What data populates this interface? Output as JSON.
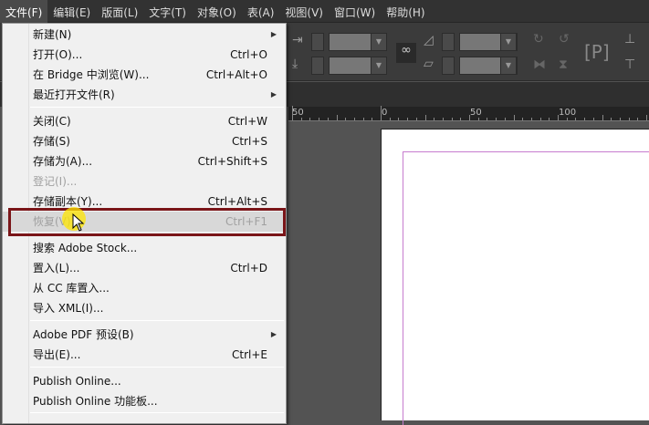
{
  "menubar": [
    "文件(F)",
    "编辑(E)",
    "版面(L)",
    "文字(T)",
    "对象(O)",
    "表(A)",
    "视图(V)",
    "窗口(W)",
    "帮助(H)"
  ],
  "ruler": [
    "50",
    "0",
    "50",
    "100"
  ],
  "file_menu": [
    {
      "label": "新建(N)",
      "shortcut": "",
      "submenu": true
    },
    {
      "label": "打开(O)...",
      "shortcut": "Ctrl+O"
    },
    {
      "label": "在 Bridge 中浏览(W)...",
      "shortcut": "Ctrl+Alt+O"
    },
    {
      "label": "最近打开文件(R)",
      "shortcut": "",
      "submenu": true
    },
    {
      "label": "关闭(C)",
      "shortcut": "Ctrl+W"
    },
    {
      "label": "存储(S)",
      "shortcut": "Ctrl+S"
    },
    {
      "label": "存储为(A)...",
      "shortcut": "Ctrl+Shift+S"
    },
    {
      "label": "登记(I)...",
      "shortcut": "",
      "disabled": true
    },
    {
      "label": "存储副本(Y)...",
      "shortcut": "Ctrl+Alt+S"
    },
    {
      "label": "恢复(V)",
      "shortcut": "Ctrl+F1",
      "disabled": true,
      "highlighted": true
    },
    {
      "label": "搜索 Adobe Stock...",
      "shortcut": ""
    },
    {
      "label": "置入(L)...",
      "shortcut": "Ctrl+D"
    },
    {
      "label": "从 CC 库置入...",
      "shortcut": ""
    },
    {
      "label": "导入 XML(I)...",
      "shortcut": ""
    },
    {
      "label": "Adobe PDF 预设(B)",
      "shortcut": "",
      "submenu": true
    },
    {
      "label": "导出(E)...",
      "shortcut": "Ctrl+E"
    },
    {
      "label": "Publish Online...",
      "shortcut": ""
    },
    {
      "label": "Publish Online 功能板...",
      "shortcut": ""
    }
  ],
  "colors": {
    "highlight_box": "#7a1518",
    "guide": "#c77ccf"
  }
}
